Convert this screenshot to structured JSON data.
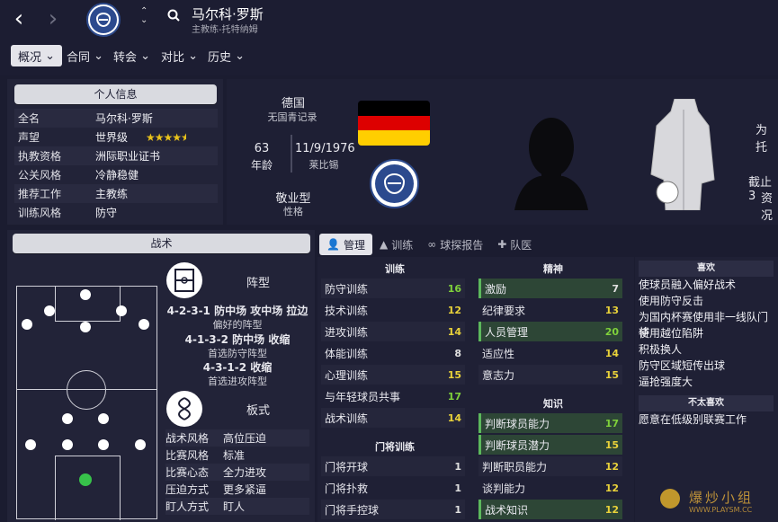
{
  "header": {
    "name": "马尔科·罗斯",
    "subtitle": "主教练-托特纳姆",
    "back_icon": "chevron-left-icon",
    "forward_icon": "chevron-right-icon"
  },
  "menu": [
    {
      "label": "概况"
    },
    {
      "label": "合同"
    },
    {
      "label": "转会"
    },
    {
      "label": "对比"
    },
    {
      "label": "历史"
    }
  ],
  "personal": {
    "title": "个人信息",
    "rows": [
      {
        "k": "全名",
        "v": "马尔科·罗斯"
      },
      {
        "k": "声望",
        "v": "世界级",
        "stars": 4.5
      },
      {
        "k": "执教资格",
        "v": "洲际职业证书"
      },
      {
        "k": "公关风格",
        "v": "冷静稳健"
      },
      {
        "k": "推荐工作",
        "v": "主教练"
      },
      {
        "k": "训练风格",
        "v": "防守"
      }
    ]
  },
  "profile": {
    "country": "德国",
    "youth": "无国青记录",
    "age": "63",
    "age_label": "年龄",
    "dob": "11/9/1976",
    "birthplace": "莱比锡",
    "personality": "敬业型",
    "personality_label": "性格",
    "flag_colors": [
      "#000000",
      "#dd0000",
      "#ffce00"
    ]
  },
  "side_text": {
    "top": "为托",
    "mid": "截止3",
    "mid2": "资况"
  },
  "tactics": {
    "title": "战术",
    "formation_title": "阵型",
    "formation_lines": [
      {
        "t": "4-2-3-1 防中场 攻中场 拉边",
        "b": "偏好的阵型"
      },
      {
        "t": "4-1-3-2 防中场 收缩",
        "b": "首选防守阵型"
      },
      {
        "t": "4-3-1-2 收缩",
        "b": "首选进攻阵型"
      }
    ],
    "style_title": "板式",
    "style_rows": [
      {
        "k": "战术风格",
        "v": "高位压迫"
      },
      {
        "k": "比赛风格",
        "v": "标准"
      },
      {
        "k": "比赛心态",
        "v": "全力进攻"
      },
      {
        "k": "压迫方式",
        "v": "更多紧逼"
      },
      {
        "k": "盯人方式",
        "v": "盯人"
      }
    ]
  },
  "tabs": [
    {
      "label": "管理",
      "icon": "people-icon"
    },
    {
      "label": "训练",
      "icon": "cone-icon"
    },
    {
      "label": "球探报告",
      "icon": "binoculars-icon"
    },
    {
      "label": "队医",
      "icon": "medkit-icon"
    }
  ],
  "training": {
    "header": "训练",
    "rows": [
      {
        "n": "防守训练",
        "v": "16",
        "c": "g"
      },
      {
        "n": "技术训练",
        "v": "12",
        "c": "y"
      },
      {
        "n": "进攻训练",
        "v": "14",
        "c": "y"
      },
      {
        "n": "体能训练",
        "v": "8",
        "c": "w"
      },
      {
        "n": "心理训练",
        "v": "15",
        "c": "y"
      },
      {
        "n": "与年轻球员共事",
        "v": "17",
        "c": "g"
      },
      {
        "n": "战术训练",
        "v": "14",
        "c": "y"
      }
    ]
  },
  "gk": {
    "header": "门将训练",
    "rows": [
      {
        "n": "门将开球",
        "v": "1",
        "c": "w"
      },
      {
        "n": "门将扑救",
        "v": "1",
        "c": "w"
      },
      {
        "n": "门将手控球",
        "v": "1",
        "c": "w"
      }
    ]
  },
  "mental": {
    "header": "精神",
    "rows": [
      {
        "n": "激励",
        "v": "7",
        "c": "w",
        "hl": true
      },
      {
        "n": "纪律要求",
        "v": "13",
        "c": "y"
      },
      {
        "n": "人员管理",
        "v": "20",
        "c": "g",
        "hl": true
      },
      {
        "n": "适应性",
        "v": "14",
        "c": "y"
      },
      {
        "n": "意志力",
        "v": "15",
        "c": "y"
      }
    ]
  },
  "knowledge": {
    "header": "知识",
    "rows": [
      {
        "n": "判断球员能力",
        "v": "17",
        "c": "g",
        "hl": true
      },
      {
        "n": "判断球员潜力",
        "v": "15",
        "c": "y",
        "hl": true
      },
      {
        "n": "判断职员能力",
        "v": "12",
        "c": "y"
      },
      {
        "n": "谈判能力",
        "v": "12",
        "c": "y"
      },
      {
        "n": "战术知识",
        "v": "12",
        "c": "y",
        "hl": true
      }
    ]
  },
  "prefs": {
    "like_header": "喜欢",
    "likes": [
      "使球员融入偏好战术",
      "使用防守反击",
      "为国内杯赛使用非一线队门将",
      "使用越位陷阱",
      "积极换人",
      "防守区域短传出球",
      "逼抢强度大"
    ],
    "dislike_header": "不太喜欢",
    "dislikes": [
      "愿意在低级别联赛工作"
    ]
  },
  "watermark": {
    "t1": "爆炒小组",
    "t2": "WWW.PLAYSM.CC"
  }
}
